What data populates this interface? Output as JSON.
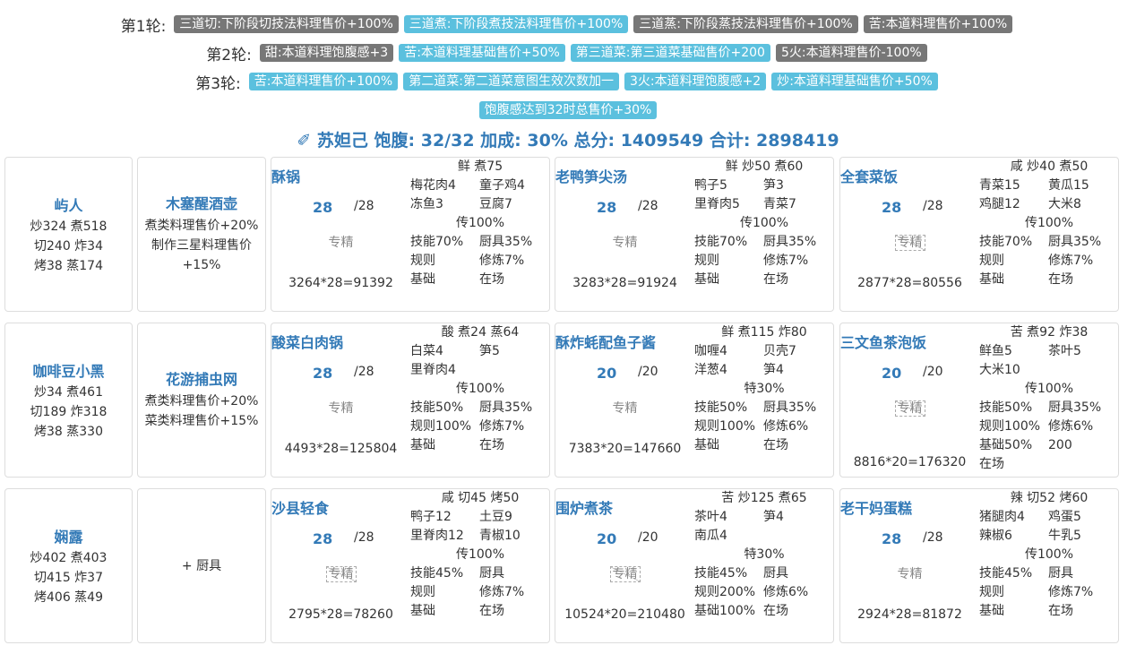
{
  "rounds": [
    {
      "label": "第1轮:",
      "tags": [
        {
          "text": "三道切:下阶段切技法料理售价+100%",
          "color": "gray"
        },
        {
          "text": "三道煮:下阶段煮技法料理售价+100%",
          "color": "blue"
        },
        {
          "text": "三道蒸:下阶段蒸技法料理售价+100%",
          "color": "gray"
        },
        {
          "text": "苦:本道料理售价+100%",
          "color": "gray"
        }
      ]
    },
    {
      "label": "第2轮:",
      "tags": [
        {
          "text": "甜:本道料理饱腹感+3",
          "color": "gray"
        },
        {
          "text": "苦:本道料理基础售价+50%",
          "color": "blue"
        },
        {
          "text": "第三道菜:第三道菜基础售价+200",
          "color": "blue"
        },
        {
          "text": "5火:本道料理售价-100%",
          "color": "gray"
        }
      ]
    },
    {
      "label": "第3轮:",
      "tags": [
        {
          "text": "苦:本道料理售价+100%",
          "color": "blue"
        },
        {
          "text": "第二道菜:第二道菜意图生效次数加一",
          "color": "blue"
        },
        {
          "text": "3火:本道料理饱腹感+2",
          "color": "blue"
        },
        {
          "text": "炒:本道料理基础售价+50%",
          "color": "blue"
        }
      ]
    },
    {
      "label": "",
      "tags": [
        {
          "text": "饱腹感达到32时总售价+30%",
          "color": "blue"
        }
      ]
    }
  ],
  "summary": "✐ 苏妲己 饱腹: 32/32 加成: 30% 总分: 1409549 合计: 2898419",
  "colors": {
    "gray": "#777777",
    "blue": "#5bc0de",
    "accent": "#337ab7"
  },
  "rows": [
    {
      "chef": {
        "name": "屿人",
        "stats": [
          "炒324 煮518",
          "切240 炸34",
          "烤38 蒸174"
        ]
      },
      "equip": {
        "name": "木塞醒酒壶",
        "lines": [
          "煮类料理售价+20%",
          "制作三星料理售价",
          "+15%"
        ]
      },
      "dishes": [
        {
          "name": "酥锅",
          "qty": "28",
          "max": "/28",
          "spec": "专精",
          "spec_off": false,
          "calc": "3264*28=91392",
          "flavor": "鲜  煮75",
          "ing": [
            [
              "梅花肉4",
              "童子鸡4"
            ],
            [
              "冻鱼3",
              "豆腐7"
            ]
          ],
          "center": "传100%",
          "stats": [
            [
              "技能70%",
              "厨具35%"
            ],
            [
              "规则",
              "修炼7%"
            ],
            [
              "基础",
              "在场"
            ]
          ],
          "extra": ""
        },
        {
          "name": "老鸭笋尖汤",
          "qty": "28",
          "max": "/28",
          "spec": "专精",
          "spec_off": false,
          "calc": "3283*28=91924",
          "flavor": "鲜  炒50  煮60",
          "ing": [
            [
              "鸭子5",
              "笋3"
            ],
            [
              "里脊肉5",
              "青菜7"
            ]
          ],
          "center": "传100%",
          "stats": [
            [
              "技能70%",
              "厨具35%"
            ],
            [
              "规则",
              "修炼7%"
            ],
            [
              "基础",
              "在场"
            ]
          ],
          "extra": ""
        },
        {
          "name": "全套菜饭",
          "qty": "28",
          "max": "/28",
          "spec": "专精",
          "spec_off": true,
          "calc": "2877*28=80556",
          "flavor": "咸  炒40  煮50",
          "ing": [
            [
              "青菜15",
              "黄瓜15"
            ],
            [
              "鸡腿12",
              "大米8"
            ]
          ],
          "center": "传100%",
          "stats": [
            [
              "技能70%",
              "厨具35%"
            ],
            [
              "规则",
              "修炼7%"
            ],
            [
              "基础",
              "在场"
            ]
          ],
          "extra": ""
        }
      ]
    },
    {
      "chef": {
        "name": "咖啡豆小黑",
        "stats": [
          "炒34 煮461",
          "切189 炸318",
          "烤38 蒸330"
        ]
      },
      "equip": {
        "name": "花游捕虫网",
        "lines": [
          "煮类料理售价+20%",
          "菜类料理售价+15%"
        ]
      },
      "dishes": [
        {
          "name": "酸菜白肉锅",
          "qty": "28",
          "max": "/28",
          "spec": "专精",
          "spec_off": false,
          "calc": "4493*28=125804",
          "flavor": "酸  煮24  蒸64",
          "ing": [
            [
              "白菜4",
              "笋5"
            ],
            [
              "里脊肉4",
              ""
            ]
          ],
          "center": "传100%",
          "stats": [
            [
              "技能50%",
              "厨具35%"
            ],
            [
              "规则100%",
              "修炼7%"
            ],
            [
              "基础",
              "在场"
            ]
          ],
          "extra": ""
        },
        {
          "name": "酥炸蚝配鱼子酱",
          "qty": "20",
          "max": "/20",
          "spec": "专精",
          "spec_off": false,
          "calc": "7383*20=147660",
          "flavor": "鲜  煮115  炸80",
          "ing": [
            [
              "咖喱4",
              "贝壳7"
            ],
            [
              "洋葱4",
              "笋4"
            ]
          ],
          "center": "特30%",
          "stats": [
            [
              "技能50%",
              "厨具35%"
            ],
            [
              "规则100%",
              "修炼6%"
            ],
            [
              "基础",
              "在场"
            ]
          ],
          "extra": ""
        },
        {
          "name": "三文鱼茶泡饭",
          "qty": "20",
          "max": "/20",
          "spec": "专精",
          "spec_off": true,
          "calc": "8816*20=176320",
          "flavor": "苦  煮92  炸38",
          "ing": [
            [
              "鲜鱼5",
              "茶叶5"
            ],
            [
              "大米10",
              ""
            ]
          ],
          "center": "传100%",
          "stats": [
            [
              "技能50%",
              "厨具35%"
            ],
            [
              "规则100%",
              "修炼6%"
            ],
            [
              "基础50%",
              "200"
            ]
          ],
          "extra": "在场"
        }
      ]
    },
    {
      "chef": {
        "name": "娴露",
        "stats": [
          "炒402 煮403",
          "切415 炸37",
          "烤406 蒸49"
        ]
      },
      "equip": {
        "name": "",
        "lines": [
          "+ 厨具"
        ]
      },
      "dishes": [
        {
          "name": "沙县轻食",
          "qty": "28",
          "max": "/28",
          "spec": "专精",
          "spec_off": true,
          "calc": "2795*28=78260",
          "flavor": "咸  切45  烤50",
          "ing": [
            [
              "鸭子12",
              "土豆9"
            ],
            [
              "里脊肉12",
              "青椒10"
            ]
          ],
          "center": "传100%",
          "stats": [
            [
              "技能45%",
              "厨具"
            ],
            [
              "规则",
              "修炼7%"
            ],
            [
              "基础",
              "在场"
            ]
          ],
          "extra": ""
        },
        {
          "name": "围炉煮茶",
          "qty": "20",
          "max": "/20",
          "spec": "专精",
          "spec_off": true,
          "calc": "10524*20=210480",
          "flavor": "苦  炒125  煮65",
          "ing": [
            [
              "茶叶4",
              "笋4"
            ],
            [
              "南瓜4",
              ""
            ]
          ],
          "center": "特30%",
          "stats": [
            [
              "技能45%",
              "厨具"
            ],
            [
              "规则200%",
              "修炼6%"
            ],
            [
              "基础100%",
              "在场"
            ]
          ],
          "extra": ""
        },
        {
          "name": "老干妈蛋糕",
          "qty": "28",
          "max": "/28",
          "spec": "专精",
          "spec_off": false,
          "calc": "2924*28=81872",
          "flavor": "辣  切52  烤60",
          "ing": [
            [
              "猪腿肉4",
              "鸡蛋5"
            ],
            [
              "辣椒6",
              "牛乳5"
            ]
          ],
          "center": "传100%",
          "stats": [
            [
              "技能45%",
              "厨具"
            ],
            [
              "规则",
              "修炼7%"
            ],
            [
              "基础",
              "在场"
            ]
          ],
          "extra": ""
        }
      ]
    }
  ]
}
